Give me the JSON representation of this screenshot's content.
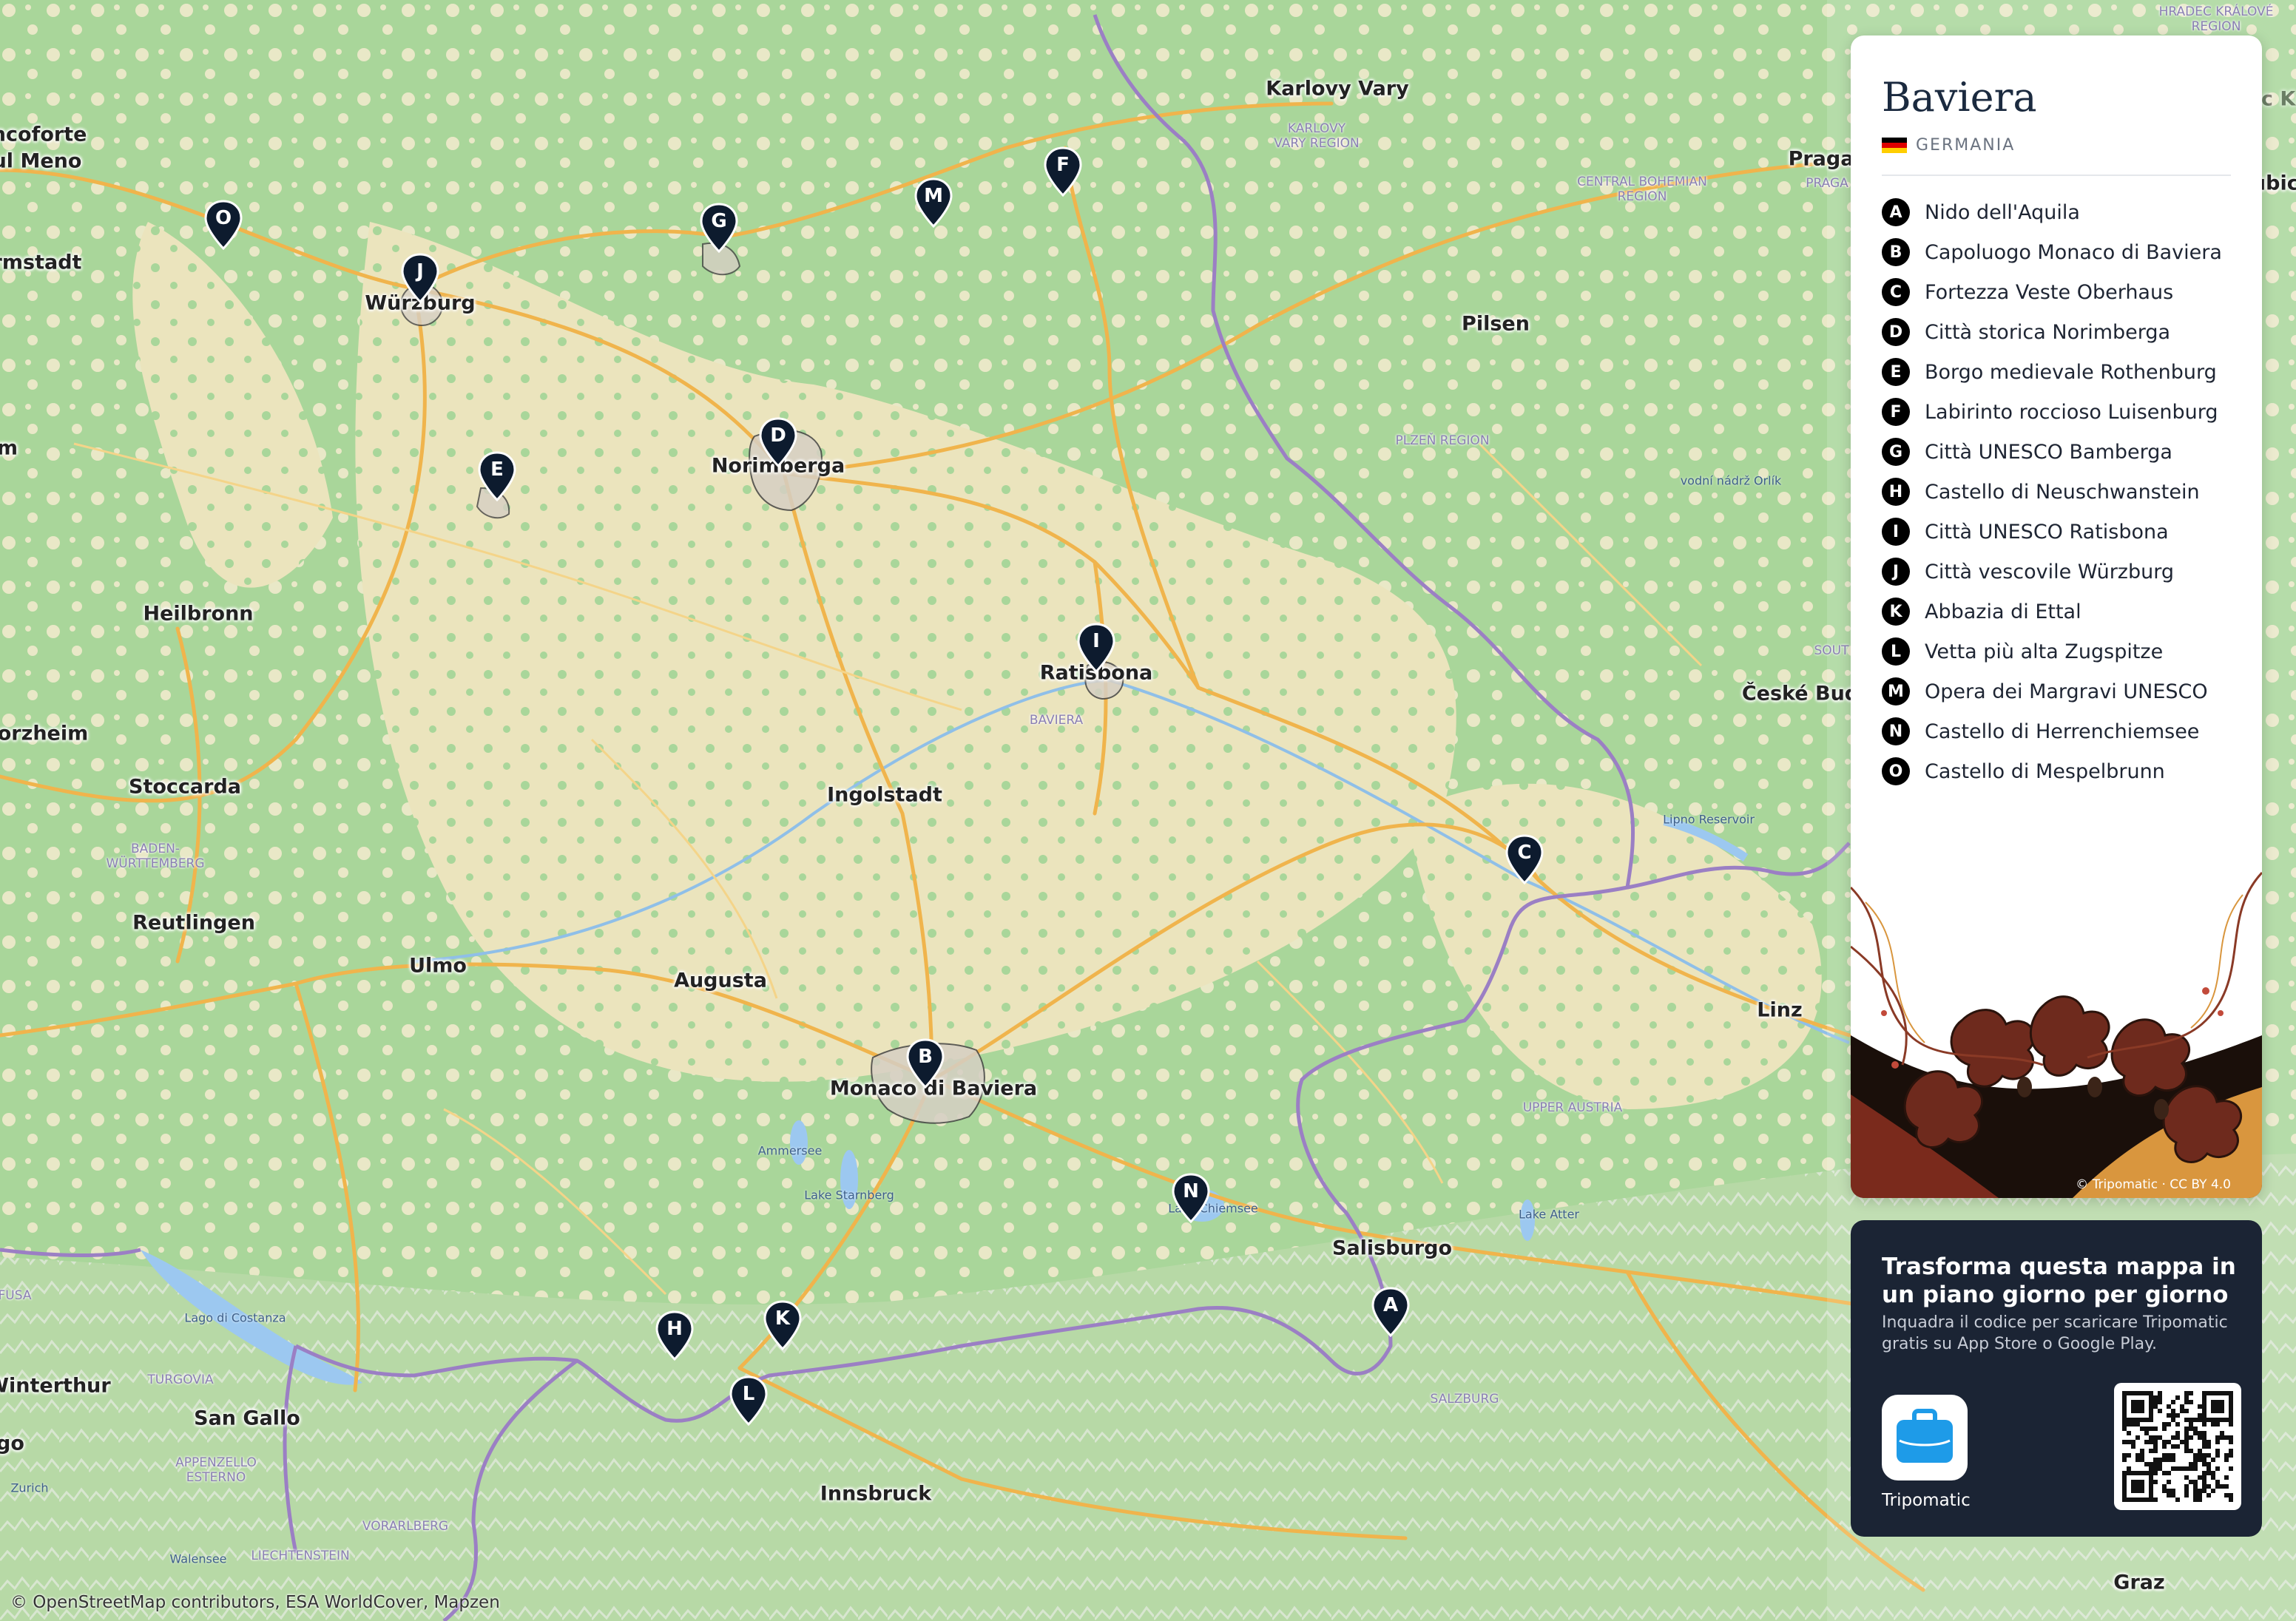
{
  "panel": {
    "title": "Baviera",
    "country": "GERMANIA",
    "art_credit": "© Tripomatic · CC BY 4.0",
    "pois": [
      {
        "letter": "A",
        "name": "Nido dell'Aquila"
      },
      {
        "letter": "B",
        "name": "Capoluogo Monaco di Baviera"
      },
      {
        "letter": "C",
        "name": "Fortezza Veste Oberhaus"
      },
      {
        "letter": "D",
        "name": "Città storica Norimberga"
      },
      {
        "letter": "E",
        "name": "Borgo medievale Rothenburg"
      },
      {
        "letter": "F",
        "name": "Labirinto roccioso Luisenburg"
      },
      {
        "letter": "G",
        "name": "Città UNESCO Bamberga"
      },
      {
        "letter": "H",
        "name": "Castello di Neuschwanstein"
      },
      {
        "letter": "I",
        "name": "Città UNESCO Ratisbona"
      },
      {
        "letter": "J",
        "name": "Città vescovile Würzburg"
      },
      {
        "letter": "K",
        "name": "Abbazia di Ettal"
      },
      {
        "letter": "L",
        "name": "Vetta più alta Zugspitze"
      },
      {
        "letter": "M",
        "name": "Opera dei Margravi UNESCO"
      },
      {
        "letter": "N",
        "name": "Castello di Herrenchiemsee"
      },
      {
        "letter": "O",
        "name": "Castello di Mespelbrunn"
      }
    ]
  },
  "promo": {
    "title": "Trasforma questa mappa in un piano giorno per giorno",
    "text": "Inquadra il codice per scaricare Tripomatic gratis su App Store o Google Play.",
    "app_name": "Tripomatic"
  },
  "map": {
    "attribution": "© OpenStreetMap contributors, ESA WorldCover, Mapzen",
    "cities": [
      {
        "id": "francoforte",
        "label": "ancoforte"
      },
      {
        "id": "meno",
        "label": "ul Meno"
      },
      {
        "id": "darmstadt",
        "label": "rmstadt"
      },
      {
        "id": "wurzburg",
        "label": "Würzburg"
      },
      {
        "id": "norimberga",
        "label": "Norimberga"
      },
      {
        "id": "karlovy",
        "label": "Karlovy Vary"
      },
      {
        "id": "pilsen",
        "label": "Pilsen"
      },
      {
        "id": "praga",
        "label": "Praga"
      },
      {
        "id": "heilbronn",
        "label": "Heilbronn"
      },
      {
        "id": "pforzheim",
        "label": "orzheim"
      },
      {
        "id": "stoccarda",
        "label": "Stoccarda"
      },
      {
        "id": "ratisbona",
        "label": "Ratisbona"
      },
      {
        "id": "ingolstadt",
        "label": "Ingolstadt"
      },
      {
        "id": "reutlingen",
        "label": "Reutlingen"
      },
      {
        "id": "ulmo",
        "label": "Ulmo"
      },
      {
        "id": "augusta",
        "label": "Augusta"
      },
      {
        "id": "monaco",
        "label": "Monaco di Baviera"
      },
      {
        "id": "salisburgo",
        "label": "Salisburgo"
      },
      {
        "id": "linz",
        "label": "Linz"
      },
      {
        "id": "budejovice",
        "label": "České Bud"
      },
      {
        "id": "winterthur",
        "label": "Winterthur"
      },
      {
        "id": "sangallo",
        "label": "San Gallo"
      },
      {
        "id": "innsbruck",
        "label": "Innsbruck"
      },
      {
        "id": "graz",
        "label": "Graz"
      },
      {
        "id": "hradec",
        "label": "Hradec Kra"
      },
      {
        "id": "pardubice",
        "label": "Pardubice"
      },
      {
        "id": "m_left",
        "label": "m"
      },
      {
        "id": "go_left",
        "label": "go"
      }
    ],
    "regions": [
      {
        "id": "karlovy_reg",
        "label": "KARLOVY\nVARY REGION"
      },
      {
        "id": "central_boh",
        "label": "CENTRAL BOHEMIAN\nREGION"
      },
      {
        "id": "plzen",
        "label": "PLZEŇ REGION"
      },
      {
        "id": "praha",
        "label": "PRAGA"
      },
      {
        "id": "baviera",
        "label": "BAVIERA"
      },
      {
        "id": "baden",
        "label": "BADEN-\nWÜRTTEMBERG"
      },
      {
        "id": "upper_austria",
        "label": "UPPER AUSTRIA"
      },
      {
        "id": "salzburg",
        "label": "SALZBURG"
      },
      {
        "id": "turgovia",
        "label": "TURGOVIA"
      },
      {
        "id": "appenzello",
        "label": "APPENZELLO\nESTERNO"
      },
      {
        "id": "vorarlberg",
        "label": "VORARLBERG"
      },
      {
        "id": "liechtenstein",
        "label": "LIECHTENSTEIN"
      },
      {
        "id": "hradec_reg",
        "label": "HRADEC KRÁLOVÉ\nREGION"
      },
      {
        "id": "fusa",
        "label": "FUSA"
      },
      {
        "id": "sout",
        "label": "SOUT"
      }
    ],
    "waters": [
      {
        "id": "costanza",
        "label": "Lago di Costanza"
      },
      {
        "id": "ammersee",
        "label": "Ammersee"
      },
      {
        "id": "starnberg",
        "label": "Lake Starnberg"
      },
      {
        "id": "chiemsee",
        "label": "Lake Chiemsee"
      },
      {
        "id": "attersee",
        "label": "Lake Atter"
      },
      {
        "id": "lipno",
        "label": "Lipno Reservoir"
      },
      {
        "id": "orlik",
        "label": "vodní nádrž Orlík"
      },
      {
        "id": "zurich",
        "label": "Zurich"
      },
      {
        "id": "walensee",
        "label": "Walensee"
      }
    ],
    "pins": [
      "A",
      "B",
      "C",
      "D",
      "E",
      "F",
      "G",
      "H",
      "I",
      "J",
      "K",
      "L",
      "M",
      "N",
      "O"
    ]
  }
}
